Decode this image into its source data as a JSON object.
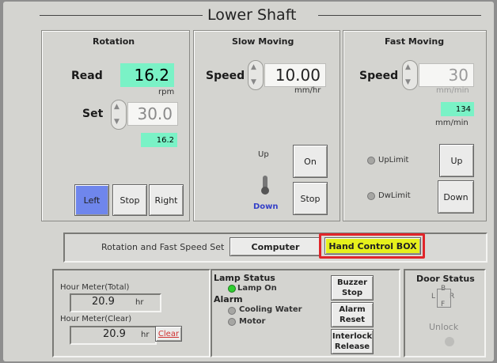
{
  "title": "Lower Shaft",
  "rotation": {
    "header": "Rotation",
    "read_label": "Read",
    "read_value": "16.2",
    "read_unit": "rpm",
    "set_label": "Set",
    "set_value": "30.0",
    "small_value": "16.2",
    "buttons": {
      "left": "Left",
      "stop": "Stop",
      "right": "Right"
    }
  },
  "slow": {
    "header": "Slow Moving",
    "speed_label": "Speed",
    "speed_value": "10.00",
    "speed_unit": "mm/hr",
    "up_label": "Up",
    "down_label": "Down",
    "on_label": "On",
    "stop_label": "Stop"
  },
  "fast": {
    "header": "Fast Moving",
    "speed_label": "Speed",
    "speed_value": "30",
    "speed_unit": "mm/min",
    "read_value": "134",
    "read_unit": "mm/min",
    "uplimit": "UpLimit",
    "dwlimit": "DwLimit",
    "up_label": "Up",
    "down_label": "Down"
  },
  "speedset": {
    "label": "Rotation and Fast Speed Set",
    "computer": "Computer",
    "hand": "Hand Control BOX"
  },
  "hour": {
    "total_label": "Hour Meter(Total)",
    "total_value": "20.9",
    "total_unit": "hr",
    "clear_label": "Hour Meter(Clear)",
    "clear_value": "20.9",
    "clear_unit": "hr",
    "clear_button": "Clear"
  },
  "status": {
    "lamp_title": "Lamp Status",
    "lamp_on": "Lamp On",
    "alarm_title": "Alarm",
    "cooling": "Cooling Water",
    "motor": "Motor",
    "buzzer": "Buzzer Stop",
    "alarm_reset": "Alarm Reset",
    "interlock": "Interlock Release"
  },
  "door": {
    "title": "Door Status",
    "unlock": "Unlock",
    "keys": {
      "b": "B",
      "l": "L",
      "r": "R",
      "f": "F"
    }
  },
  "colors": {
    "accent_green": "#7af2c6",
    "hand_yellow": "#e6f01c",
    "hand_border": "#e0252a",
    "pressed_blue": "#6f86ec"
  }
}
